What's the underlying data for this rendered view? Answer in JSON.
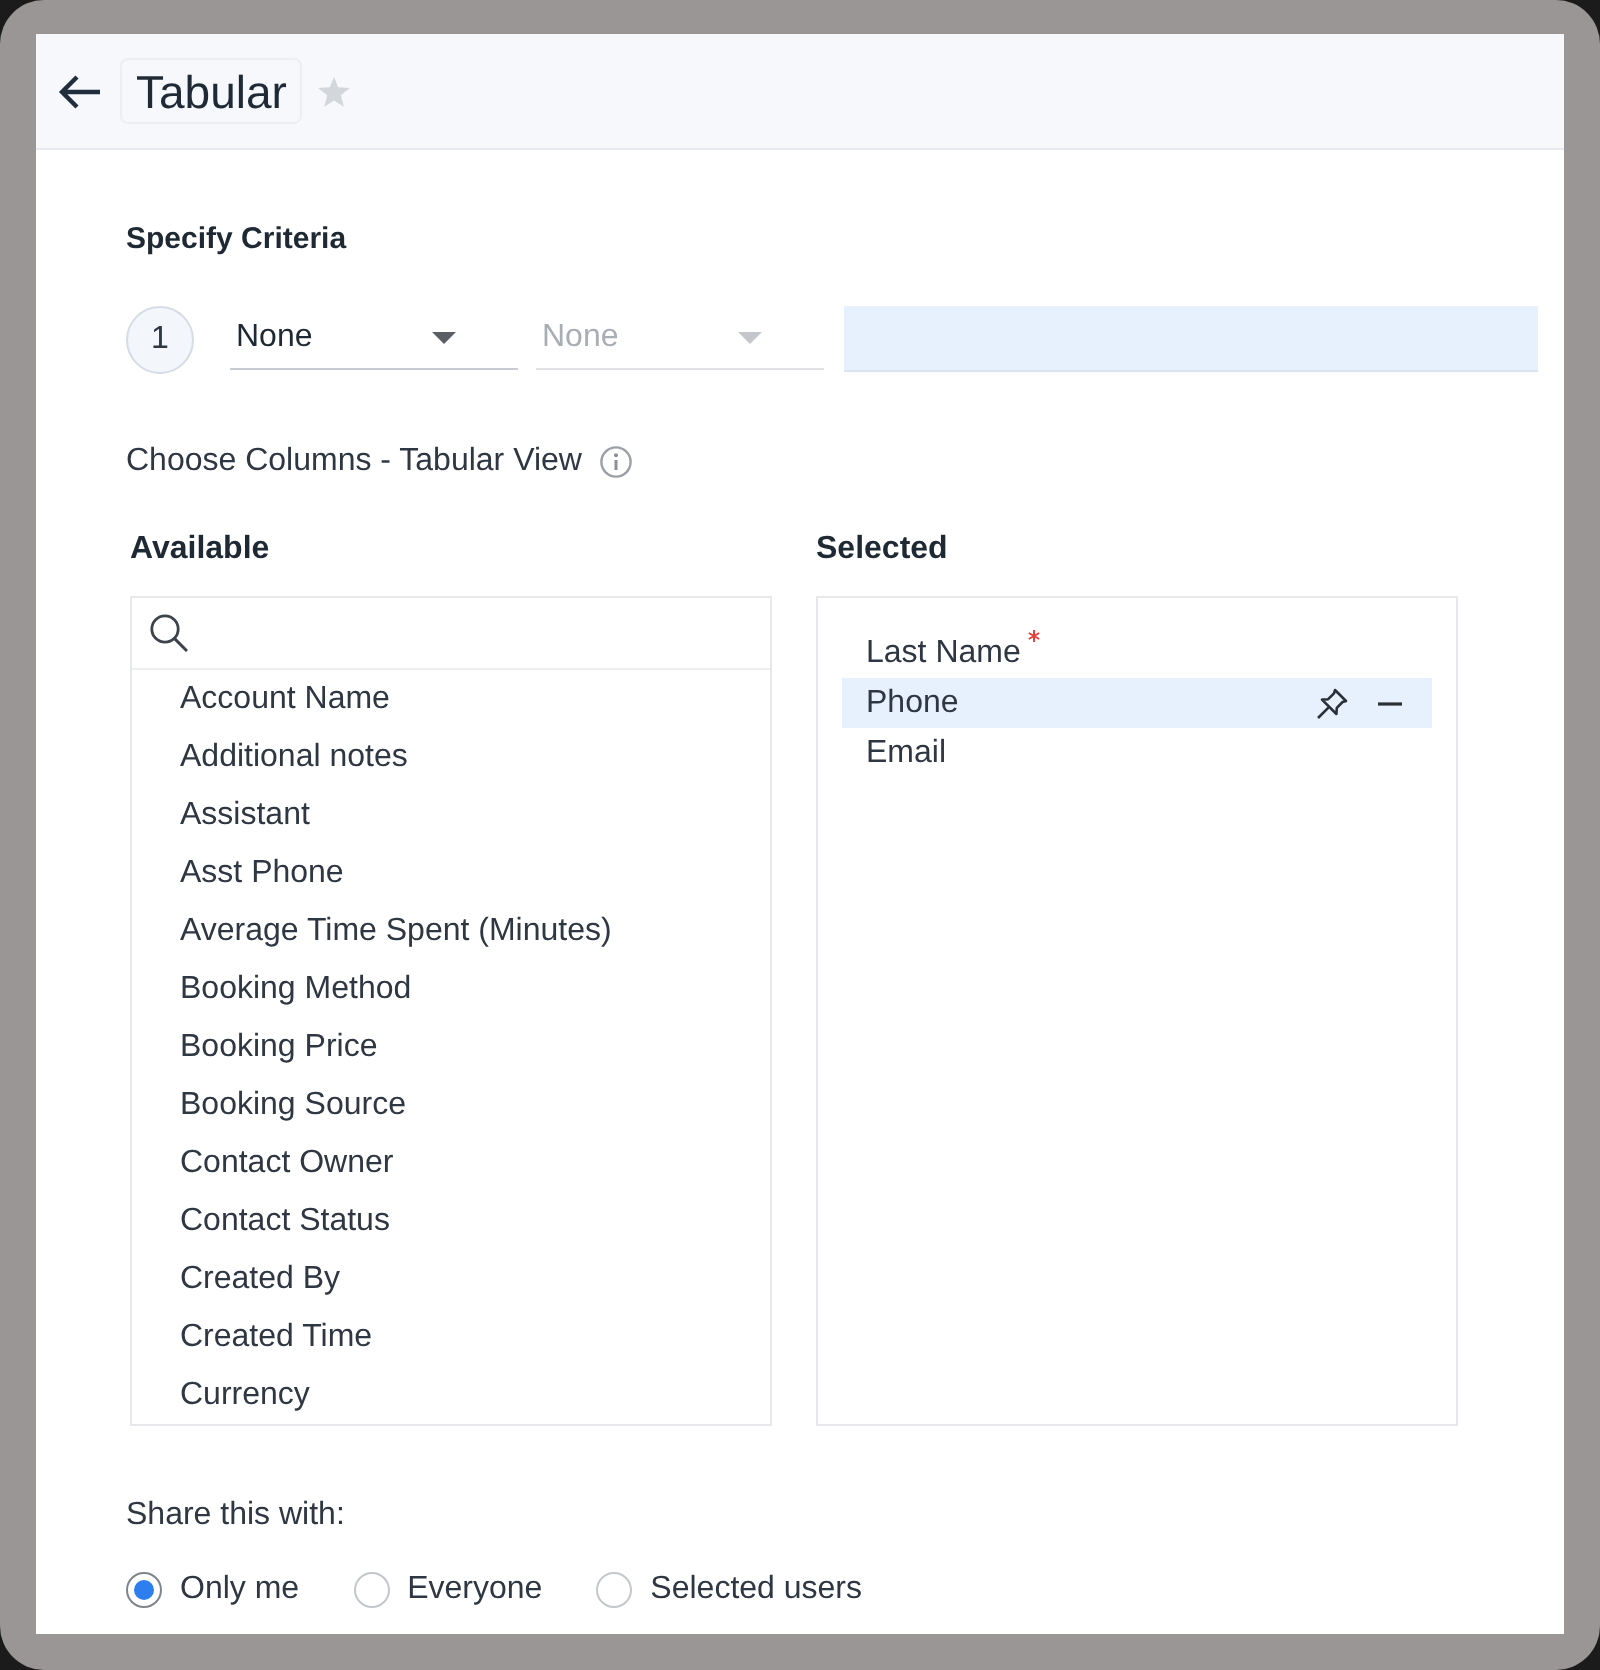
{
  "header": {
    "title": "Tabular",
    "favorite": false
  },
  "criteria": {
    "heading": "Specify Criteria",
    "rows": [
      {
        "number": "1",
        "field": {
          "value": "None",
          "disabled": false
        },
        "operator": {
          "value": "None",
          "disabled": true
        }
      }
    ]
  },
  "columns": {
    "heading": "Choose Columns - Tabular View",
    "available": {
      "heading": "Available",
      "items": [
        "Account Name",
        "Additional notes",
        "Assistant",
        "Asst Phone",
        "Average Time Spent (Minutes)",
        "Booking Method",
        "Booking Price",
        "Booking Source",
        "Contact Owner",
        "Contact Status",
        "Created By",
        "Created Time",
        "Currency"
      ]
    },
    "selected": {
      "heading": "Selected",
      "items": [
        {
          "label": "Last Name",
          "required": true,
          "selected": false
        },
        {
          "label": "Phone",
          "required": false,
          "selected": true
        },
        {
          "label": "Email",
          "required": false,
          "selected": false
        }
      ]
    }
  },
  "share": {
    "label": "Share this with:",
    "options": [
      {
        "label": "Only me",
        "selected": true
      },
      {
        "label": "Everyone",
        "selected": false
      },
      {
        "label": "Selected users",
        "selected": false
      }
    ]
  }
}
